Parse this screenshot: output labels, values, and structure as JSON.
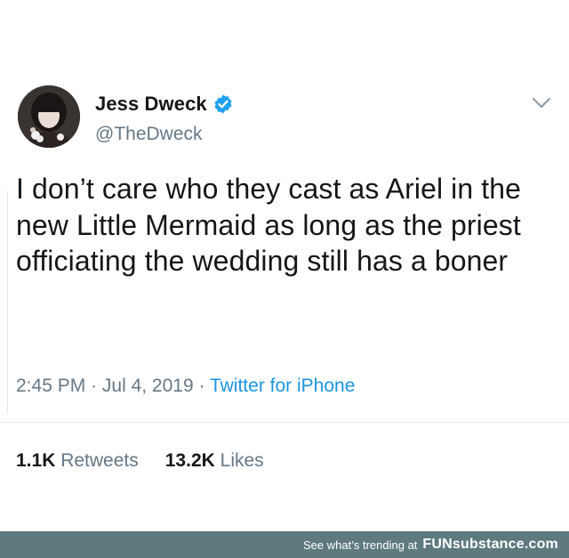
{
  "tweet": {
    "author_name": "Jess Dweck",
    "author_handle": "@TheDweck",
    "verified_icon": "verified-badge-icon",
    "menu_icon": "chevron-down-icon",
    "text": "I don’t care who they cast as Ariel in the new Little Mermaid as long as the priest officiating the wedding still has a boner",
    "time": "2:45 PM",
    "date": "Jul 4, 2019",
    "source": "Twitter for iPhone",
    "separator": "·",
    "retweets_count": "1.1K",
    "retweets_label": "Retweets",
    "likes_count": "13.2K",
    "likes_label": "Likes"
  },
  "footer": {
    "trending_text": "See what’s trending at",
    "brand": "FUNsubstance.com"
  },
  "colors": {
    "text": "#14171a",
    "muted": "#657786",
    "link": "#1b95e0",
    "verified": "#1da1f2",
    "footer_bg": "#5e7a7f"
  }
}
